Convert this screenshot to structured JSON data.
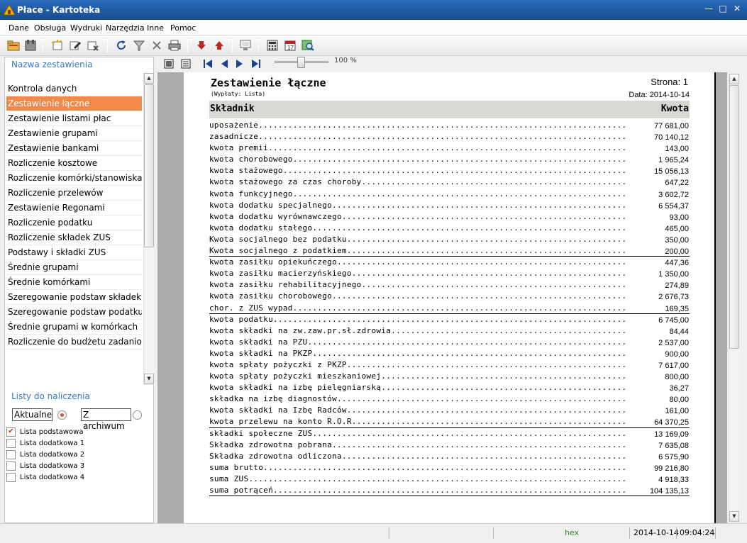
{
  "window": {
    "title": "Płace - Kartoteka"
  },
  "menu": [
    "Dane",
    "Obsługa",
    "Wydruki",
    "Narzędzia",
    "Inne",
    "Pomoc"
  ],
  "left": {
    "reports_header": "Nazwa zestawienia",
    "reports": [
      "Kontrola danych",
      "Zestawienie łączne",
      "Zestawienie listami płac",
      "Zestawienie grupami",
      "Zestawienie bankami",
      "Rozliczenie kosztowe",
      "Rozliczenie komórki/stanowiska",
      "Rozliczenie przelewów",
      "Zestawienie Regonami",
      "Rozliczenie podatku",
      "Rozliczenie składek ZUS",
      "Podstawy i składki ZUS",
      "Średnie grupami",
      "Średnie komórkami",
      "Szeregowanie podstaw składek",
      "Szeregowanie podstaw podatku",
      "Średnie grupami w komórkach",
      "Rozliczenie do budżetu zadaniowego"
    ],
    "selected_report": "Zestawienie łączne",
    "lists_header": "Listy do naliczenia",
    "radio_current": "Aktualne",
    "radio_archive": "Z archiwum",
    "radio_selected": "Aktualne",
    "lists": [
      {
        "label": "Lista podstawowa",
        "checked": true
      },
      {
        "label": "Lista dodatkowa 1",
        "checked": false
      },
      {
        "label": "Lista dodatkowa 2",
        "checked": false
      },
      {
        "label": "Lista dodatkowa 3",
        "checked": false
      },
      {
        "label": "Lista dodatkowa 4",
        "checked": false
      }
    ]
  },
  "viewer": {
    "zoom": "100 %",
    "zoom_percent": 100
  },
  "report": {
    "title": "Zestawienie łączne",
    "subtitle": "(Wypłaty: Lista)",
    "page": "Strona: 1",
    "date": "Data: 2014-10-14",
    "col_name": "Składnik",
    "col_amount": "Kwota",
    "rows": [
      {
        "label": "uposażenie",
        "value": "77 681,00",
        "line": false
      },
      {
        "label": "zasadnicze",
        "value": "70 140,12",
        "line": false
      },
      {
        "label": "kwota premii",
        "value": "143,00",
        "line": false
      },
      {
        "label": "kwota chorobowego",
        "value": "1 965,24",
        "line": false
      },
      {
        "label": "kwota stażowego",
        "value": "15 056,13",
        "line": false
      },
      {
        "label": "kwota stażowego za czas choroby",
        "value": "647,22",
        "line": false
      },
      {
        "label": "kwota funkcyjnego",
        "value": "3 602,72",
        "line": false
      },
      {
        "label": "kwota dodatku specjalnego",
        "value": "6 554,37",
        "line": false
      },
      {
        "label": "kwota dodatku wyrównawczego",
        "value": "93,00",
        "line": false
      },
      {
        "label": "kwota dodatku stałego",
        "value": "465,00",
        "line": false
      },
      {
        "label": "Kwota socjalnego bez podatku",
        "value": "350,00",
        "line": false
      },
      {
        "label": "Kwota socjalnego z podatkiem",
        "value": "200,00",
        "line": true
      },
      {
        "label": "kwota zasiłku opiekuńczego",
        "value": "447,36",
        "line": false
      },
      {
        "label": "kwota zasiłku macierzyńskiego",
        "value": "1 350,00",
        "line": false
      },
      {
        "label": "kwota zasiłku rehabilitacyjnego",
        "value": "274,89",
        "line": false
      },
      {
        "label": "kwota zasiłku chorobowego",
        "value": "2 676,73",
        "line": false
      },
      {
        "label": "chor. z ZUS wypad.",
        "value": "169,35",
        "line": true
      },
      {
        "label": "kwota podatku",
        "value": "6 745,00",
        "line": false
      },
      {
        "label": "kwota składki na zw.zaw.pr.sł.zdrowia",
        "value": "84,44",
        "line": false
      },
      {
        "label": "kwota składki na PZU",
        "value": "2 537,00",
        "line": false
      },
      {
        "label": "kwota składki na PKZP",
        "value": "900,00",
        "line": false
      },
      {
        "label": "kwota spłaty pożyczki z PKZP",
        "value": "7 617,00",
        "line": false
      },
      {
        "label": "kwota spłaty pożyczki mieszkaniowej",
        "value": "800,00",
        "line": false
      },
      {
        "label": "kwota składki na izbę pielęgniarską",
        "value": "36,27",
        "line": false
      },
      {
        "label": "składka na izbę diagnostów",
        "value": "80,00",
        "line": false
      },
      {
        "label": "kwota składki na Izbę Radców",
        "value": "161,00",
        "line": false
      },
      {
        "label": "kwota przelewu na konto R.O.R.",
        "value": "64 370,25",
        "line": true
      },
      {
        "label": "składki społeczne ZUS",
        "value": "13 169,09",
        "line": false
      },
      {
        "label": "Składka zdrowotna pobrana",
        "value": "7 635,08",
        "line": false
      },
      {
        "label": "Składka zdrowotna odliczona",
        "value": "6 575,90",
        "line": false
      },
      {
        "label": "suma brutto",
        "value": "99 216,80",
        "line": false
      },
      {
        "label": "suma ZUS",
        "value": "4 918,33",
        "line": false
      },
      {
        "label": "suma potrąceń",
        "value": "104 135,13",
        "line": true
      }
    ]
  },
  "status": {
    "mode": "hex",
    "date": "2014-10-14",
    "time": "09:04:24"
  }
}
